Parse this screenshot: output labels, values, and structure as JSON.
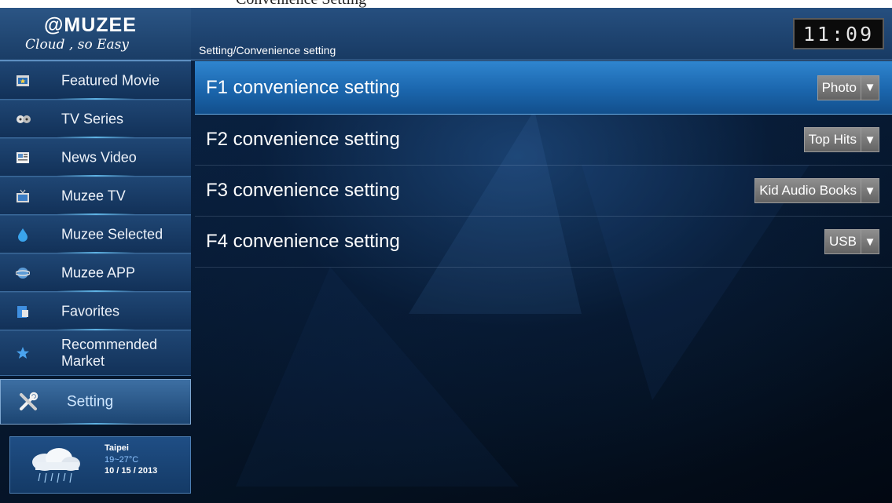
{
  "window_caption": "Convenience Setting",
  "logo": {
    "brand": "@MUZEE",
    "tagline": "Cloud , so Easy"
  },
  "header": {
    "breadcrumb": "Setting/Convenience setting",
    "clock": "11:09"
  },
  "sidebar": {
    "items": [
      {
        "label": "Featured Movie",
        "icon": "film-icon"
      },
      {
        "label": "TV Series",
        "icon": "reel-icon"
      },
      {
        "label": "News Video",
        "icon": "newspaper-icon"
      },
      {
        "label": "Muzee TV",
        "icon": "tv-icon"
      },
      {
        "label": "Muzee Selected",
        "icon": "droplet-icon"
      },
      {
        "label": "Muzee APP",
        "icon": "globe-icon"
      },
      {
        "label": "Favorites",
        "icon": "bookmark-icon"
      },
      {
        "label": "Recommended Market",
        "icon": "star-icon"
      },
      {
        "label": "Setting",
        "icon": "tools-icon",
        "active": true
      }
    ]
  },
  "weather": {
    "city": "Taipei",
    "temp": "19~27°C",
    "date": "10 / 15 / 2013",
    "icon": "rain-cloud-icon"
  },
  "settings": [
    {
      "title": "F1 convenience setting",
      "value": "Photo",
      "selected": true
    },
    {
      "title": "F2 convenience setting",
      "value": "Top Hits"
    },
    {
      "title": "F3 convenience setting",
      "value": "Kid Audio Books"
    },
    {
      "title": "F4 convenience setting",
      "value": "USB"
    }
  ],
  "colors": {
    "accent": "#2f85cf",
    "sidebar": "#1f4674",
    "highlight_text": "#cfe7ff"
  }
}
